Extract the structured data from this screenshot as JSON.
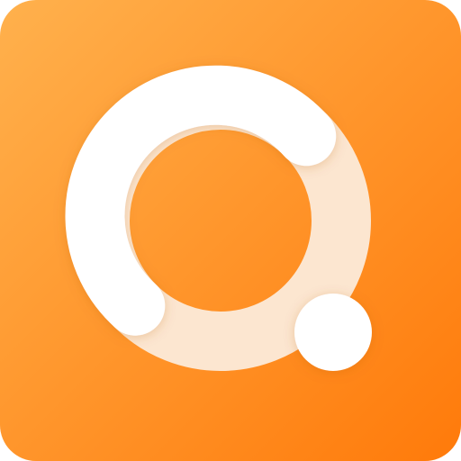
{
  "icon": {
    "name": "app-icon",
    "glyph": "ring-with-dot-icon",
    "colors": {
      "gradient_start": "#FFB14D",
      "gradient_end": "#FF7A0A",
      "ring_primary": "#FFFFFF",
      "ring_track": "#FCE6D0",
      "dot": "#FFFFFF"
    }
  }
}
